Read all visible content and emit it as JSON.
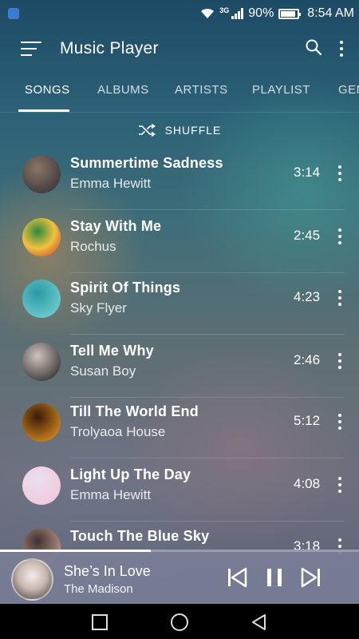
{
  "status_bar": {
    "network_type": "3G",
    "battery_percent": "90%",
    "battery_level": 0.9,
    "time": "8:54 AM"
  },
  "app_bar": {
    "title": "Music Player",
    "icons": [
      "menu-icon",
      "search-icon",
      "more-vertical-icon"
    ]
  },
  "tabs": [
    {
      "label": "SONGS",
      "active": true
    },
    {
      "label": "ALBUMS",
      "active": false
    },
    {
      "label": "ARTISTS",
      "active": false
    },
    {
      "label": "PLAYLIST",
      "active": false
    },
    {
      "label": "GEN",
      "active": false
    }
  ],
  "shuffle": {
    "label": "SHUFFLE",
    "icon": "shuffle-icon"
  },
  "songs": [
    {
      "title": "Summertime Sadness",
      "artist": "Emma Hewitt",
      "duration": "3:14",
      "art_colors": [
        "#2b2b33",
        "#8a7666"
      ]
    },
    {
      "title": "Stay With Me",
      "artist": "Rochus",
      "duration": "2:45",
      "art_colors": [
        "#c8382a",
        "#f0c040",
        "#2e8a3c"
      ]
    },
    {
      "title": "Spirit Of Things",
      "artist": "Sky Flyer",
      "duration": "4:23",
      "art_colors": [
        "#7fd6d6",
        "#2a9aa6"
      ]
    },
    {
      "title": "Tell Me Why",
      "artist": "Susan Boy",
      "duration": "2:46",
      "art_colors": [
        "#1a1a1e",
        "#cfc4bc"
      ]
    },
    {
      "title": "Till The World End",
      "artist": "Trolyaoa House",
      "duration": "5:12",
      "art_colors": [
        "#f0a020",
        "#3a1a0a"
      ]
    },
    {
      "title": "Light Up The Day",
      "artist": "Emma Hewitt",
      "duration": "4:08",
      "art_colors": [
        "#f6c2d6",
        "#e8e0f0"
      ]
    },
    {
      "title": "Touch The Blue Sky",
      "artist": "",
      "duration": "3:18",
      "art_colors": [
        "#d8b0a0",
        "#403030"
      ]
    }
  ],
  "mini_player": {
    "title": "She’s In Love",
    "artist": "The Madison",
    "progress": 0.42,
    "controls": [
      "skip-previous-icon",
      "pause-icon",
      "skip-next-icon"
    ]
  },
  "nav_bar": {
    "buttons": [
      "recents-square-icon",
      "home-circle-icon",
      "back-triangle-icon"
    ]
  }
}
